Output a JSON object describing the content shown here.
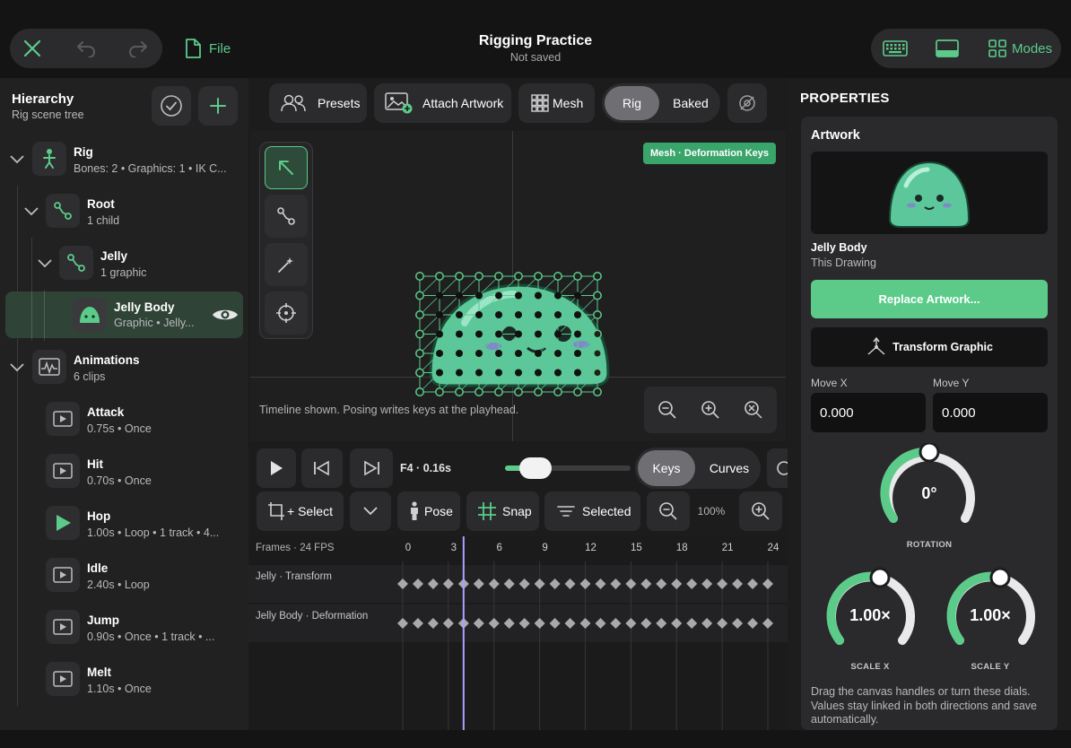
{
  "topbar": {
    "file_label": "File",
    "doc_title": "Rigging Practice",
    "doc_status": "Not saved",
    "modes_label": "Modes"
  },
  "hierarchy": {
    "title": "Hierarchy",
    "subtitle": "Rig scene tree",
    "items": [
      {
        "title": "Rig",
        "sub": "Bones: 2  •  Graphics: 1  •  IK C..."
      },
      {
        "title": "Root",
        "sub": "1 child"
      },
      {
        "title": "Jelly",
        "sub": "1 graphic"
      },
      {
        "title": "Jelly Body",
        "sub": "Graphic  •  Jelly..."
      },
      {
        "title": "Animations",
        "sub": "6 clips"
      }
    ],
    "clips": [
      {
        "title": "Attack",
        "sub": "0.75s  •  Once"
      },
      {
        "title": "Hit",
        "sub": "0.70s  •  Once"
      },
      {
        "title": "Hop",
        "sub": "1.00s  •  Loop  •  1 track  •  4..."
      },
      {
        "title": "Idle",
        "sub": "2.40s  •  Loop"
      },
      {
        "title": "Jump",
        "sub": "0.90s  •  Once  •  1 track  •  ..."
      },
      {
        "title": "Melt",
        "sub": "1.10s  •  Once"
      }
    ]
  },
  "toolbar": {
    "presets": "Presets",
    "attach": "Attach Artwork",
    "mesh": "Mesh",
    "rig": "Rig",
    "baked": "Baked"
  },
  "canvas": {
    "badge": "Mesh · Deformation Keys",
    "hint": "Timeline shown. Posing writes keys at the playhead."
  },
  "playback": {
    "frame_readout": "F4 · 0.16s",
    "scrub_fraction": 0.24,
    "keys": "Keys",
    "curves": "Curves"
  },
  "tools": {
    "select": "+ Select",
    "pose": "Pose",
    "snap": "Snap",
    "selected": "Selected",
    "zoom": "100%"
  },
  "timeline": {
    "header": "Frames · 24 FPS",
    "ticks": [
      "0",
      "3",
      "6",
      "9",
      "12",
      "15",
      "18",
      "21",
      "24"
    ],
    "playhead_frame": 4,
    "tracks": [
      "Jelly · Transform",
      "Jelly Body · Deformation"
    ]
  },
  "properties": {
    "title": "PROPERTIES",
    "section": "Artwork",
    "artwork_name": "Jelly Body",
    "artwork_source": "This Drawing",
    "replace_label": "Replace Artwork...",
    "transform_label": "Transform Graphic",
    "move_x_label": "Move X",
    "move_y_label": "Move Y",
    "move_x": "0.000",
    "move_y": "0.000",
    "rotation_value": "0°",
    "rotation_label": "ROTATION",
    "scale_x_value": "1.00×",
    "scale_x_label": "SCALE X",
    "scale_y_value": "1.00×",
    "scale_y_label": "SCALE Y",
    "help": "Drag the canvas handles or turn these dials. Values stay linked in both directions and save automatically."
  },
  "colors": {
    "accent": "#5ccb8a",
    "panel": "#212122",
    "button": "#2b2b2d"
  }
}
